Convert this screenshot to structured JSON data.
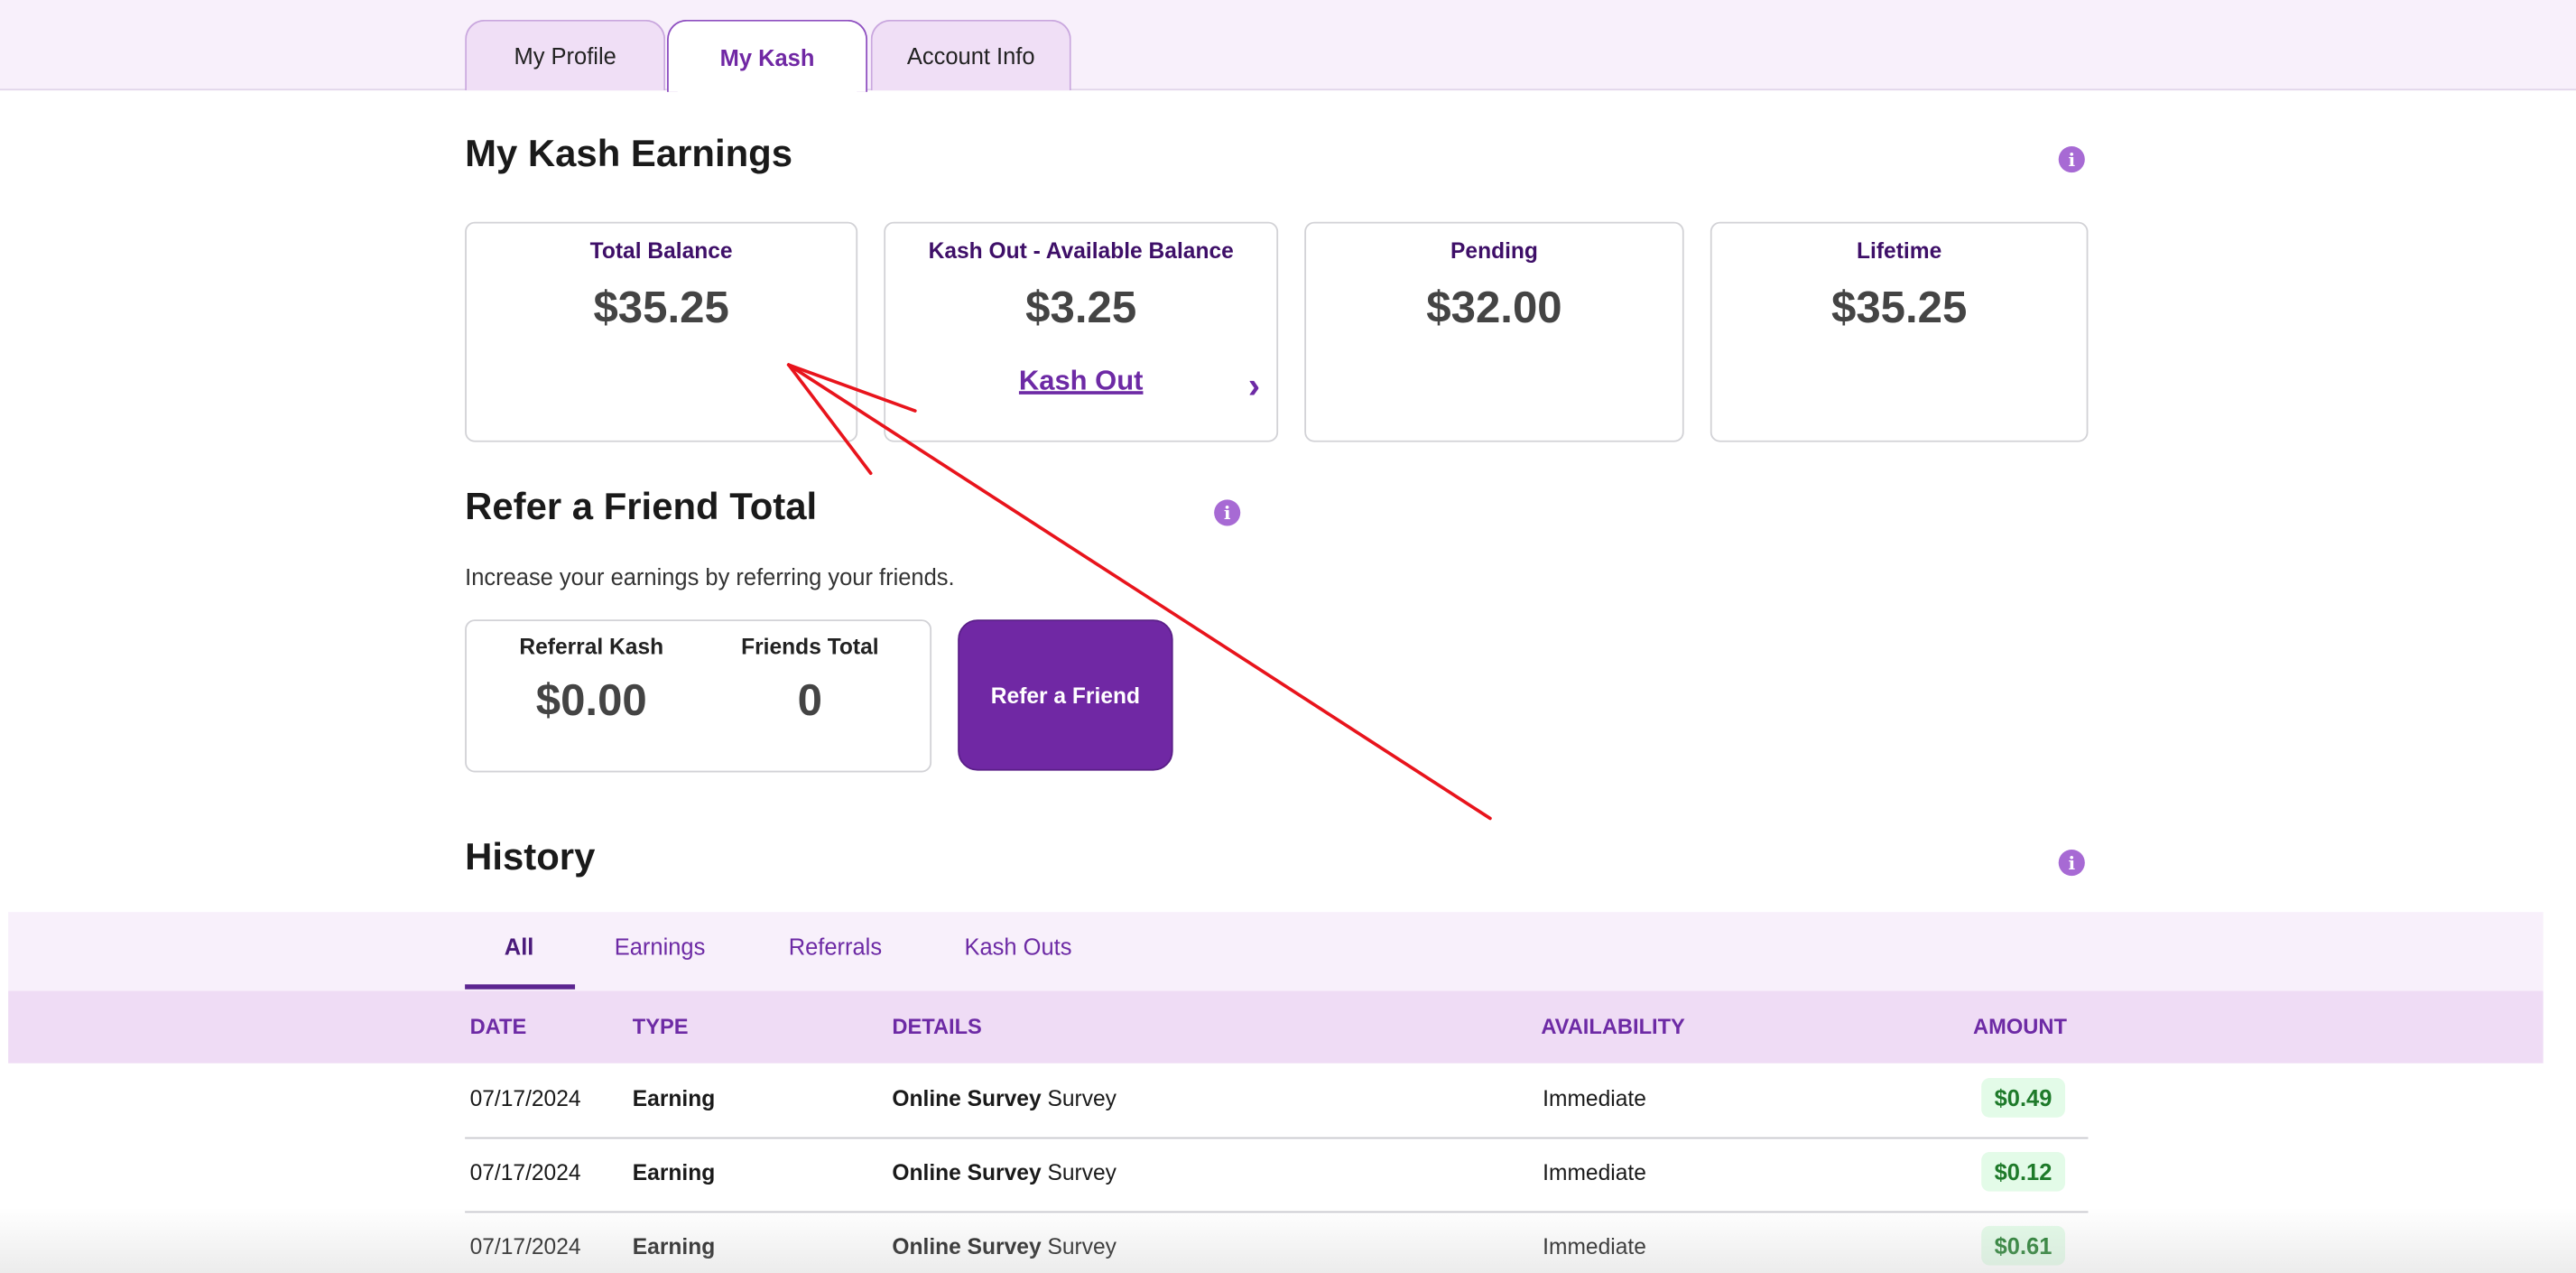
{
  "tabs": [
    {
      "label": "My Profile"
    },
    {
      "label": "My Kash",
      "active": true
    },
    {
      "label": "Account Info"
    }
  ],
  "earnings": {
    "title": "My Kash Earnings",
    "cards": [
      {
        "label": "Total Balance",
        "value": "$35.25"
      },
      {
        "label": "Kash Out - Available Balance",
        "value": "$3.25",
        "link": "Kash Out"
      },
      {
        "label": "Pending",
        "value": "$32.00"
      },
      {
        "label": "Lifetime",
        "value": "$35.25"
      }
    ]
  },
  "referral": {
    "title": "Refer a Friend Total",
    "subtitle": "Increase your earnings by referring your friends.",
    "kash_label": "Referral Kash",
    "kash_value": "$0.00",
    "friends_label": "Friends Total",
    "friends_value": "0",
    "button": "Refer a Friend"
  },
  "history": {
    "title": "History",
    "tabs": [
      {
        "label": "All",
        "active": true
      },
      {
        "label": "Earnings"
      },
      {
        "label": "Referrals"
      },
      {
        "label": "Kash Outs"
      }
    ],
    "columns": [
      "DATE",
      "TYPE",
      "DETAILS",
      "AVAILABILITY",
      "AMOUNT"
    ],
    "rows": [
      {
        "date": "07/17/2024",
        "type": "Earning",
        "detail_bold": "Online Survey",
        "detail": "Survey",
        "availability": "Immediate",
        "amount": "$0.49"
      },
      {
        "date": "07/17/2024",
        "type": "Earning",
        "detail_bold": "Online Survey",
        "detail": "Survey",
        "availability": "Immediate",
        "amount": "$0.12"
      },
      {
        "date": "07/17/2024",
        "type": "Earning",
        "detail_bold": "Online Survey",
        "detail": "Survey",
        "availability": "Immediate",
        "amount": "$0.61"
      }
    ]
  },
  "icons": {
    "info": "info-icon",
    "chevron": "chevron-right-icon"
  },
  "colors": {
    "accent": "#7028a4",
    "annotation": "#e8141c",
    "amount_green": "#1e7a2a"
  }
}
